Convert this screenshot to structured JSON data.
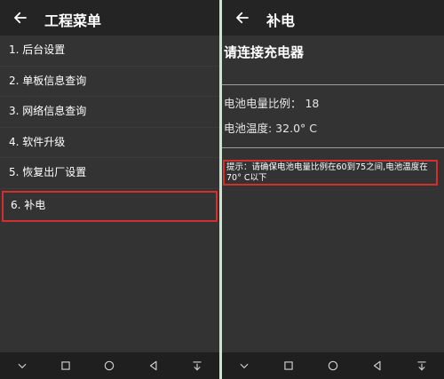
{
  "left": {
    "title": "工程菜单",
    "menu": [
      "1. 后台设置",
      "2. 单板信息查询",
      "3. 网络信息查询",
      "4. 软件升级",
      "5. 恢复出厂设置",
      "6. 补电"
    ]
  },
  "right": {
    "title": "补电",
    "headline": "请连接充电器",
    "battery_ratio_label": "电池电量比例：  18",
    "battery_temp_label": "电池温度: 32.0° C",
    "hint": "提示：请确保电池电量比例在60到75之间,电池温度在70° C以下"
  },
  "navbar": {
    "icons": [
      "chevron-down-icon",
      "square-icon",
      "circle-icon",
      "triangle-back-icon",
      "notification-pull-icon"
    ]
  },
  "colors": {
    "highlight": "#d32f2f",
    "background": "#333333",
    "appbar": "#242424",
    "divider": "#c8e6c9"
  }
}
